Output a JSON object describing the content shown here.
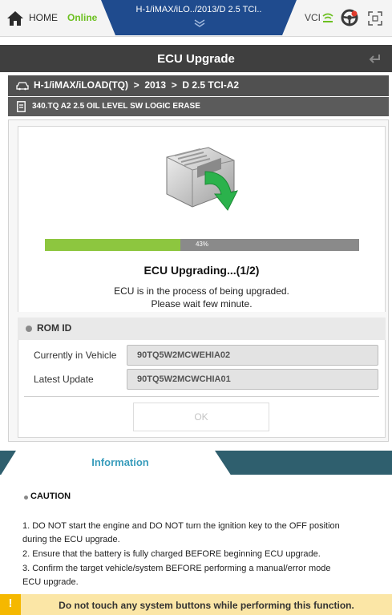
{
  "topbar": {
    "home_label": "HOME",
    "online_label": "Online",
    "vehicle_tab": "H-1/iMAX/iLO../2013/D 2.5 TCI..",
    "vci_label": "VCI"
  },
  "header": {
    "title": "ECU Upgrade"
  },
  "breadcrumb": {
    "path": "H-1/iMAX/iLOAD(TQ)  >  2013  >  D 2.5 TCI-A2"
  },
  "procedure": {
    "name": "340.TQ A2 2.5 OIL LEVEL SW LOGIC ERASE"
  },
  "progress": {
    "percent": 43,
    "label": "43%"
  },
  "status": {
    "title": "ECU Upgrading...(1/2)",
    "message_line1": "ECU is in the process of being upgraded.",
    "message_line2": "Please wait few minute."
  },
  "rom": {
    "section_label": "ROM ID",
    "current_label": "Currently in Vehicle",
    "current_value": "90TQ5W2MCWEHIA02",
    "latest_label": "Latest Update",
    "latest_value": "90TQ5W2MCWCHIA01"
  },
  "ok_button": "OK",
  "info": {
    "tab_label": "Information",
    "caution_title": "CAUTION",
    "lines": [
      "1. DO NOT start the engine and DO NOT turn the ignition key to the OFF position",
      "during the ECU upgrade.",
      "2. Ensure that the battery is fully charged BEFORE beginning ECU upgrade.",
      "3. Confirm the target vehicle/system BEFORE performing a manual/error mode",
      "ECU upgrade."
    ]
  },
  "warning": {
    "mark": "!",
    "text": "Do not touch any system buttons while performing this function."
  },
  "colors": {
    "accent_blue": "#1f4b8e",
    "online_green": "#6cc020",
    "progress_green": "#8dc63f",
    "info_teal": "#2f5f6e",
    "warning_bg": "#fbe6a6",
    "warning_icon": "#f5b800"
  }
}
